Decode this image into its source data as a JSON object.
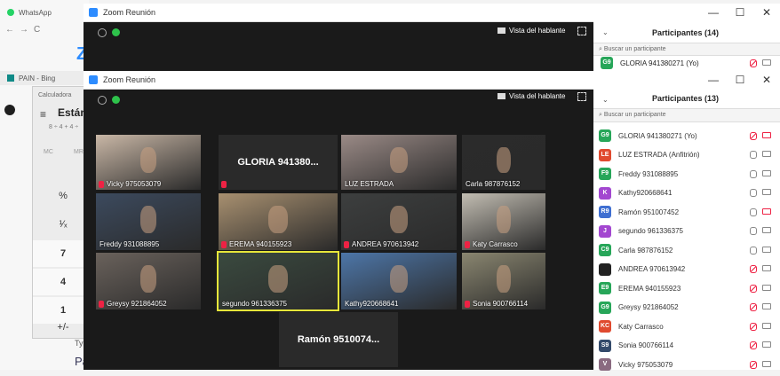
{
  "bg_browser": {
    "tab_whatsapp": "WhatsApp",
    "tab_bing": "PAIN - Bing",
    "zoom_logo": "ZC",
    "page_text_1": "Typ",
    "page_text_2": "Pa"
  },
  "calculator": {
    "title": "Calculadora",
    "mode": "Están",
    "expression": "8 ÷ 4 + 4 ÷",
    "mem_mc": "MC",
    "mem_mr": "MR",
    "buttons": [
      "%",
      "¹⁄ₓ",
      "7",
      "4",
      "1",
      "+/-"
    ]
  },
  "zoom_back": {
    "title": "Zoom Reunión",
    "speaker_view": "Vista del hablante",
    "participants_title": "Participantes (14)",
    "search_placeholder": "Buscar un participante",
    "first_participant": {
      "initials": "G9",
      "name": "GLORIA 941380271 (Yo)"
    }
  },
  "zoom_front": {
    "title": "Zoom Reunión",
    "speaker_view": "Vista del hablante",
    "participants_title": "Participantes (13)",
    "search_placeholder": "Buscar un participante",
    "tiles": [
      {
        "label": "Vicky 975053079",
        "kind": "video",
        "color": "#c9b7a6",
        "muted": true
      },
      {
        "label": "GLORIA 941380...",
        "kind": "name",
        "muted": true
      },
      {
        "label": "LUZ ESTRADA",
        "kind": "video",
        "color": "#9a8a86",
        "muted": false
      },
      {
        "label": "Carla 987876152",
        "kind": "video",
        "color": "#2b2b2b",
        "muted": false
      },
      {
        "label": "Freddy 931088895",
        "kind": "video",
        "color": "#3c4a5e",
        "muted": false
      },
      {
        "label": "EREMA 940155923",
        "kind": "video",
        "color": "#a89070",
        "muted": true
      },
      {
        "label": "ANDREA 970613942",
        "kind": "video",
        "color": "#3d3f3f",
        "muted": true
      },
      {
        "label": "Katy Carrasco",
        "kind": "video",
        "color": "#c2bdb2",
        "muted": true
      },
      {
        "label": "Greysy 921864052",
        "kind": "video",
        "color": "#6a625c",
        "muted": true
      },
      {
        "label": "segundo 961336375",
        "kind": "video",
        "color": "#3a4a3f",
        "muted": false
      },
      {
        "label": "Kathy920668641",
        "kind": "video",
        "color": "#4d76a8",
        "muted": false
      },
      {
        "label": "Sonia 900766114",
        "kind": "video",
        "color": "#8a8670",
        "muted": true
      },
      {
        "label": "Ramón 9510074...",
        "kind": "name",
        "muted": false
      }
    ],
    "participants": [
      {
        "initials": "G9",
        "color": "#27a659",
        "name": "GLORIA 941380271 (Yo)",
        "mic": "muted",
        "cam": "off"
      },
      {
        "initials": "LE",
        "color": "#e04a2f",
        "name": "LUZ ESTRADA (Anfitrión)",
        "mic": "on",
        "cam": "on"
      },
      {
        "initials": "F9",
        "color": "#27a659",
        "name": "Freddy 931088895",
        "mic": "on",
        "cam": "on"
      },
      {
        "initials": "K",
        "color": "#a347d0",
        "name": "Kathy920668641",
        "mic": "on",
        "cam": "on"
      },
      {
        "initials": "R9",
        "color": "#3f6fd1",
        "name": "Ramón 951007452",
        "mic": "on",
        "cam": "off"
      },
      {
        "initials": "J",
        "color": "#a347d0",
        "name": "segundo 961336375",
        "mic": "on",
        "cam": "on"
      },
      {
        "initials": "C9",
        "color": "#27a659",
        "name": "Carla 987876152",
        "mic": "on",
        "cam": "on"
      },
      {
        "initials": "",
        "color": "#222222",
        "name": "ANDREA 970613942",
        "mic": "muted",
        "cam": "on"
      },
      {
        "initials": "E9",
        "color": "#27a659",
        "name": "EREMA 940155923",
        "mic": "muted",
        "cam": "on"
      },
      {
        "initials": "G9",
        "color": "#27a659",
        "name": "Greysy 921864052",
        "mic": "muted",
        "cam": "on"
      },
      {
        "initials": "KC",
        "color": "#e04a2f",
        "name": "Katy Carrasco",
        "mic": "muted",
        "cam": "on"
      },
      {
        "initials": "S9",
        "color": "#334a6b",
        "name": "Sonia 900766114",
        "mic": "muted",
        "cam": "on"
      },
      {
        "initials": "V",
        "color": "#8a6a80",
        "name": "Vicky 975053079",
        "mic": "muted",
        "cam": "on"
      }
    ]
  }
}
